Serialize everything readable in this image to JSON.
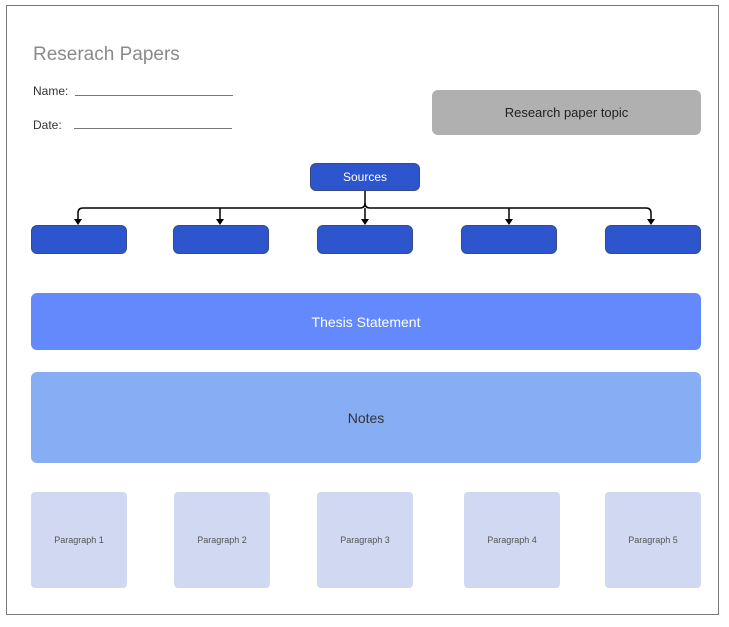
{
  "title": "Reserach Papers",
  "name_label": "Name:",
  "date_label": "Date:",
  "topic": "Research paper topic",
  "sources": "Sources",
  "thesis": "Thesis Statement",
  "notes": "Notes",
  "paragraphs": [
    "Paragraph 1",
    "Paragraph 2",
    "Paragraph 3",
    "Paragraph 4",
    "Paragraph 5"
  ],
  "colors": {
    "source_blue": "#2d55ce",
    "thesis": "#6389fd",
    "notes": "#87adf5",
    "paragraph": "#d1d9f2",
    "topic": "#b0b0b0"
  }
}
